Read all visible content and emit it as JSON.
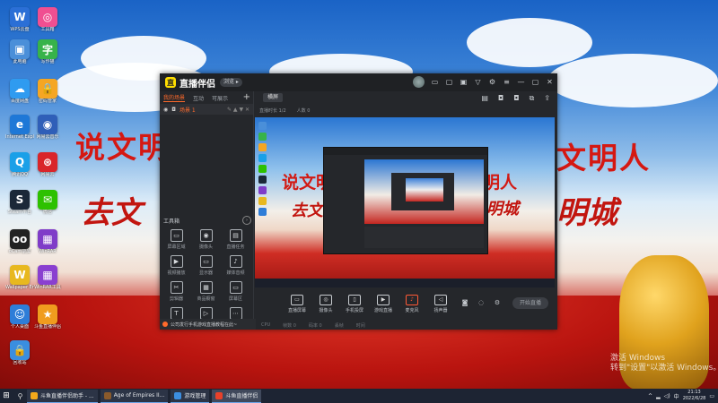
{
  "desktop": {
    "slogans": {
      "left_top": "说文明",
      "right_top": "文明人",
      "left_bottom": "去文",
      "right_bottom": "明城"
    },
    "watermark": "激活 Windows\n转到\"设置\"以激活 Windows。",
    "icons": [
      {
        "label": "WPS云盘",
        "glyph": "W",
        "color": "#2b6fd6"
      },
      {
        "label": "此电脑",
        "glyph": "▣",
        "color": "#4a8fd9"
      },
      {
        "label": "百度网盘",
        "glyph": "☁",
        "color": "#2f9bf0"
      },
      {
        "label": "Internet Explorer",
        "glyph": "e",
        "color": "#1e78d7"
      },
      {
        "label": "腾讯QQ",
        "glyph": "Q",
        "color": "#1aa0e8"
      },
      {
        "label": "Steam平台",
        "glyph": "S",
        "color": "#1b2838"
      },
      {
        "label": "oCam录屏",
        "glyph": "oo",
        "color": "#222222"
      },
      {
        "label": "Wallpaper Engine",
        "glyph": "W",
        "color": "#e8b81f"
      },
      {
        "label": "个人桌面",
        "glyph": "☺",
        "color": "#2e7dd8"
      },
      {
        "label": "回收站",
        "glyph": "🔒",
        "color": "#3a8ee0"
      },
      {
        "label": "工具箱",
        "glyph": "◎",
        "color": "#f04f91"
      },
      {
        "label": "写作猫",
        "glyph": "字",
        "color": "#37b34a"
      },
      {
        "label": "密码管家",
        "glyph": "🔒",
        "color": "#f5a623"
      },
      {
        "label": "网易云音乐",
        "glyph": "◉",
        "color": "#2f5fb8"
      },
      {
        "label": "网易云",
        "glyph": "⊛",
        "color": "#d9252a"
      },
      {
        "label": "微信",
        "glyph": "✉",
        "color": "#2dc100"
      },
      {
        "label": "WinRAR",
        "glyph": "▦",
        "color": "#7f3cc8"
      },
      {
        "label": "WinRAR工具",
        "glyph": "▦",
        "color": "#8a3fd0"
      },
      {
        "label": "斗鱼直播伴侣",
        "glyph": "★",
        "color": "#f09c1e"
      }
    ]
  },
  "app": {
    "name": "直播伴侣",
    "version": "浏览 ▸",
    "left_tabs": [
      "我的场景",
      "互动",
      "可展示"
    ],
    "scene_label": "场景 1",
    "tools_title": "工具箱",
    "tools": [
      "屏幕区域",
      "摄像头",
      "直播任务",
      "视频播放",
      "显示器",
      "媒体音频",
      "剪辑器",
      "商品橱窗",
      "屏幕区",
      "文字",
      "视频",
      "更多"
    ],
    "tips": "公司发行手机游戏直播教程在此~",
    "preview_tab": "横屏",
    "stats": [
      "直播时长 1/2",
      "人数 0"
    ],
    "bottom_buttons": [
      "直播屏幕",
      "摄像头",
      "手机投屏",
      "游戏直播",
      "麦克风",
      "扬声器"
    ],
    "golive": "开始直播",
    "status": [
      "CPU",
      "帧数 0",
      "码率 0",
      "丢帧",
      "时间"
    ],
    "close_glyph": "✕"
  },
  "taskbar": {
    "start_glyph": "⊞",
    "search_glyph": "⚲",
    "windows": [
      {
        "title": "斗鱼直播伴侣助手 - ...",
        "active": false,
        "color": "#f3a81b"
      },
      {
        "title": "Age of Empires II...",
        "active": false,
        "color": "#8a5a2b"
      },
      {
        "title": "游戏管理",
        "active": false,
        "color": "#3b8ee0"
      },
      {
        "title": "斗鱼直播伴侣",
        "active": true,
        "color": "#e8412a"
      }
    ],
    "clock_time": "21:13",
    "clock_date": "2022/6/28"
  }
}
